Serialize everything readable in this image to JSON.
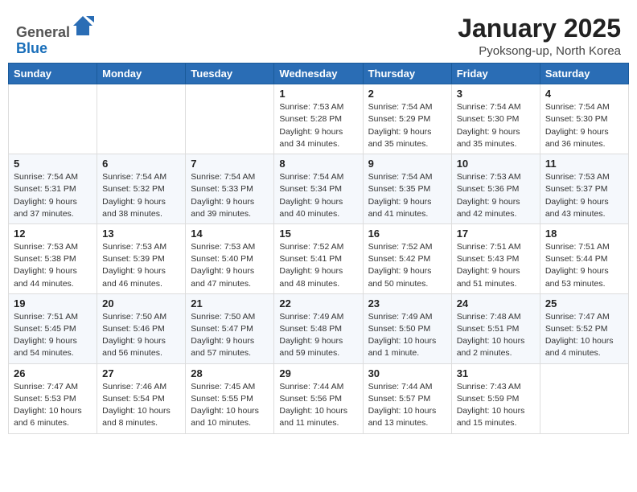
{
  "header": {
    "logo_line1": "General",
    "logo_line2": "Blue",
    "month_title": "January 2025",
    "subtitle": "Pyoksong-up, North Korea"
  },
  "weekdays": [
    "Sunday",
    "Monday",
    "Tuesday",
    "Wednesday",
    "Thursday",
    "Friday",
    "Saturday"
  ],
  "weeks": [
    [
      {
        "day": "",
        "info": ""
      },
      {
        "day": "",
        "info": ""
      },
      {
        "day": "",
        "info": ""
      },
      {
        "day": "1",
        "info": "Sunrise: 7:53 AM\nSunset: 5:28 PM\nDaylight: 9 hours\nand 34 minutes."
      },
      {
        "day": "2",
        "info": "Sunrise: 7:54 AM\nSunset: 5:29 PM\nDaylight: 9 hours\nand 35 minutes."
      },
      {
        "day": "3",
        "info": "Sunrise: 7:54 AM\nSunset: 5:30 PM\nDaylight: 9 hours\nand 35 minutes."
      },
      {
        "day": "4",
        "info": "Sunrise: 7:54 AM\nSunset: 5:30 PM\nDaylight: 9 hours\nand 36 minutes."
      }
    ],
    [
      {
        "day": "5",
        "info": "Sunrise: 7:54 AM\nSunset: 5:31 PM\nDaylight: 9 hours\nand 37 minutes."
      },
      {
        "day": "6",
        "info": "Sunrise: 7:54 AM\nSunset: 5:32 PM\nDaylight: 9 hours\nand 38 minutes."
      },
      {
        "day": "7",
        "info": "Sunrise: 7:54 AM\nSunset: 5:33 PM\nDaylight: 9 hours\nand 39 minutes."
      },
      {
        "day": "8",
        "info": "Sunrise: 7:54 AM\nSunset: 5:34 PM\nDaylight: 9 hours\nand 40 minutes."
      },
      {
        "day": "9",
        "info": "Sunrise: 7:54 AM\nSunset: 5:35 PM\nDaylight: 9 hours\nand 41 minutes."
      },
      {
        "day": "10",
        "info": "Sunrise: 7:53 AM\nSunset: 5:36 PM\nDaylight: 9 hours\nand 42 minutes."
      },
      {
        "day": "11",
        "info": "Sunrise: 7:53 AM\nSunset: 5:37 PM\nDaylight: 9 hours\nand 43 minutes."
      }
    ],
    [
      {
        "day": "12",
        "info": "Sunrise: 7:53 AM\nSunset: 5:38 PM\nDaylight: 9 hours\nand 44 minutes."
      },
      {
        "day": "13",
        "info": "Sunrise: 7:53 AM\nSunset: 5:39 PM\nDaylight: 9 hours\nand 46 minutes."
      },
      {
        "day": "14",
        "info": "Sunrise: 7:53 AM\nSunset: 5:40 PM\nDaylight: 9 hours\nand 47 minutes."
      },
      {
        "day": "15",
        "info": "Sunrise: 7:52 AM\nSunset: 5:41 PM\nDaylight: 9 hours\nand 48 minutes."
      },
      {
        "day": "16",
        "info": "Sunrise: 7:52 AM\nSunset: 5:42 PM\nDaylight: 9 hours\nand 50 minutes."
      },
      {
        "day": "17",
        "info": "Sunrise: 7:51 AM\nSunset: 5:43 PM\nDaylight: 9 hours\nand 51 minutes."
      },
      {
        "day": "18",
        "info": "Sunrise: 7:51 AM\nSunset: 5:44 PM\nDaylight: 9 hours\nand 53 minutes."
      }
    ],
    [
      {
        "day": "19",
        "info": "Sunrise: 7:51 AM\nSunset: 5:45 PM\nDaylight: 9 hours\nand 54 minutes."
      },
      {
        "day": "20",
        "info": "Sunrise: 7:50 AM\nSunset: 5:46 PM\nDaylight: 9 hours\nand 56 minutes."
      },
      {
        "day": "21",
        "info": "Sunrise: 7:50 AM\nSunset: 5:47 PM\nDaylight: 9 hours\nand 57 minutes."
      },
      {
        "day": "22",
        "info": "Sunrise: 7:49 AM\nSunset: 5:48 PM\nDaylight: 9 hours\nand 59 minutes."
      },
      {
        "day": "23",
        "info": "Sunrise: 7:49 AM\nSunset: 5:50 PM\nDaylight: 10 hours\nand 1 minute."
      },
      {
        "day": "24",
        "info": "Sunrise: 7:48 AM\nSunset: 5:51 PM\nDaylight: 10 hours\nand 2 minutes."
      },
      {
        "day": "25",
        "info": "Sunrise: 7:47 AM\nSunset: 5:52 PM\nDaylight: 10 hours\nand 4 minutes."
      }
    ],
    [
      {
        "day": "26",
        "info": "Sunrise: 7:47 AM\nSunset: 5:53 PM\nDaylight: 10 hours\nand 6 minutes."
      },
      {
        "day": "27",
        "info": "Sunrise: 7:46 AM\nSunset: 5:54 PM\nDaylight: 10 hours\nand 8 minutes."
      },
      {
        "day": "28",
        "info": "Sunrise: 7:45 AM\nSunset: 5:55 PM\nDaylight: 10 hours\nand 10 minutes."
      },
      {
        "day": "29",
        "info": "Sunrise: 7:44 AM\nSunset: 5:56 PM\nDaylight: 10 hours\nand 11 minutes."
      },
      {
        "day": "30",
        "info": "Sunrise: 7:44 AM\nSunset: 5:57 PM\nDaylight: 10 hours\nand 13 minutes."
      },
      {
        "day": "31",
        "info": "Sunrise: 7:43 AM\nSunset: 5:59 PM\nDaylight: 10 hours\nand 15 minutes."
      },
      {
        "day": "",
        "info": ""
      }
    ]
  ]
}
